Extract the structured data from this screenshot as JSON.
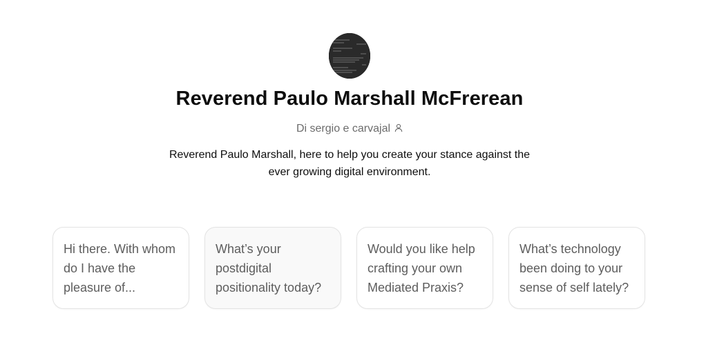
{
  "gpt": {
    "name": "Reverend Paulo Marshall McFrerean",
    "byline": "Di sergio e carvajal",
    "description": "Reverend Paulo Marshall, here to help you create your stance against the ever growing digital environment."
  },
  "icons": {
    "avatar": "dark-text-screenshot-avatar",
    "byline": "person-icon"
  },
  "colors": {
    "title": "#0d0d0d",
    "byline": "#6b6b6b",
    "card_text": "#5d5d5d",
    "card_border": "#e3e3e3",
    "card_hover_bg": "#f9f9f9"
  },
  "starters": [
    {
      "label": "Hi there. With whom do I have the pleasure of..."
    },
    {
      "label": "What’s your postdigital positionality today?"
    },
    {
      "label": "Would you like help crafting your own Mediated Praxis?"
    },
    {
      "label": "What’s technology been doing to your sense of self lately?"
    }
  ]
}
